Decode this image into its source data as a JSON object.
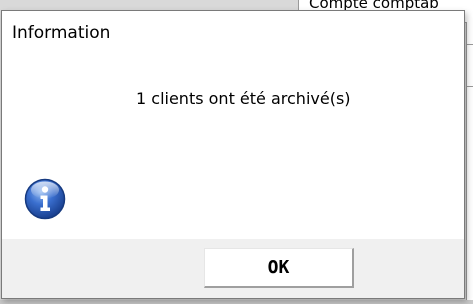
{
  "background": {
    "cell_text": "Compte comptab"
  },
  "dialog": {
    "title": "Information",
    "message": "1 clients ont été archivé(s)",
    "icon": "information-icon",
    "ok_label": "OK"
  },
  "colors": {
    "dialog_bg": "#f0f0f0",
    "content_bg": "#ffffff",
    "icon_blue": "#2a5db8"
  }
}
